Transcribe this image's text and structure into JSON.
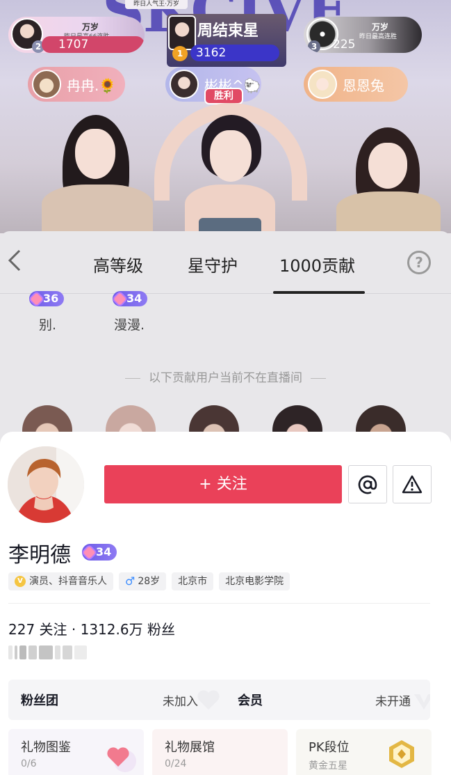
{
  "live": {
    "big_text": "SKCIVE",
    "banner": "昨日人气王·万岁",
    "ranks": [
      {
        "num": "2",
        "title": "万岁",
        "subtitle": "昨日最高66连胜",
        "score": "1707"
      },
      {
        "num": "1",
        "title": "周结束星",
        "subtitle": "",
        "score": "3162"
      },
      {
        "num": "3",
        "title": "万岁",
        "subtitle": "昨日最高连胜",
        "score": "225"
      }
    ],
    "chips": [
      {
        "name": "冉冉.🌻"
      },
      {
        "name": "彬彬^🐑"
      },
      {
        "name": "恩恩兔"
      }
    ],
    "win_label": "胜利"
  },
  "panel": {
    "tabs": [
      "高等级",
      "星守护",
      "1000贡献"
    ],
    "active_tab": "1000贡献",
    "top_users": [
      {
        "level": "36",
        "name": "别."
      },
      {
        "level": "34",
        "name": "漫漫."
      }
    ],
    "divider_text": "以下贡献用户当前不在直播间"
  },
  "profile": {
    "follow_label": "+ 关注",
    "name": "李明德",
    "level": "34",
    "tags": {
      "occupation": "演员、抖音音乐人",
      "age": "28岁",
      "city": "北京市",
      "school": "北京电影学院"
    },
    "stats": "227 关注 · 1312.6万 粉丝",
    "fan_club": {
      "label": "粉丝团",
      "value": "未加入"
    },
    "member": {
      "label": "会员",
      "value": "未开通"
    },
    "tiles": [
      {
        "title": "礼物图鉴",
        "value": "0/6"
      },
      {
        "title": "礼物展馆",
        "value": "0/24"
      },
      {
        "title": "PK段位",
        "value": "黄金五星"
      }
    ]
  },
  "colors": {
    "follow": "#ea4159",
    "level_badge": "#7b68ee",
    "win": "#e14a64"
  }
}
